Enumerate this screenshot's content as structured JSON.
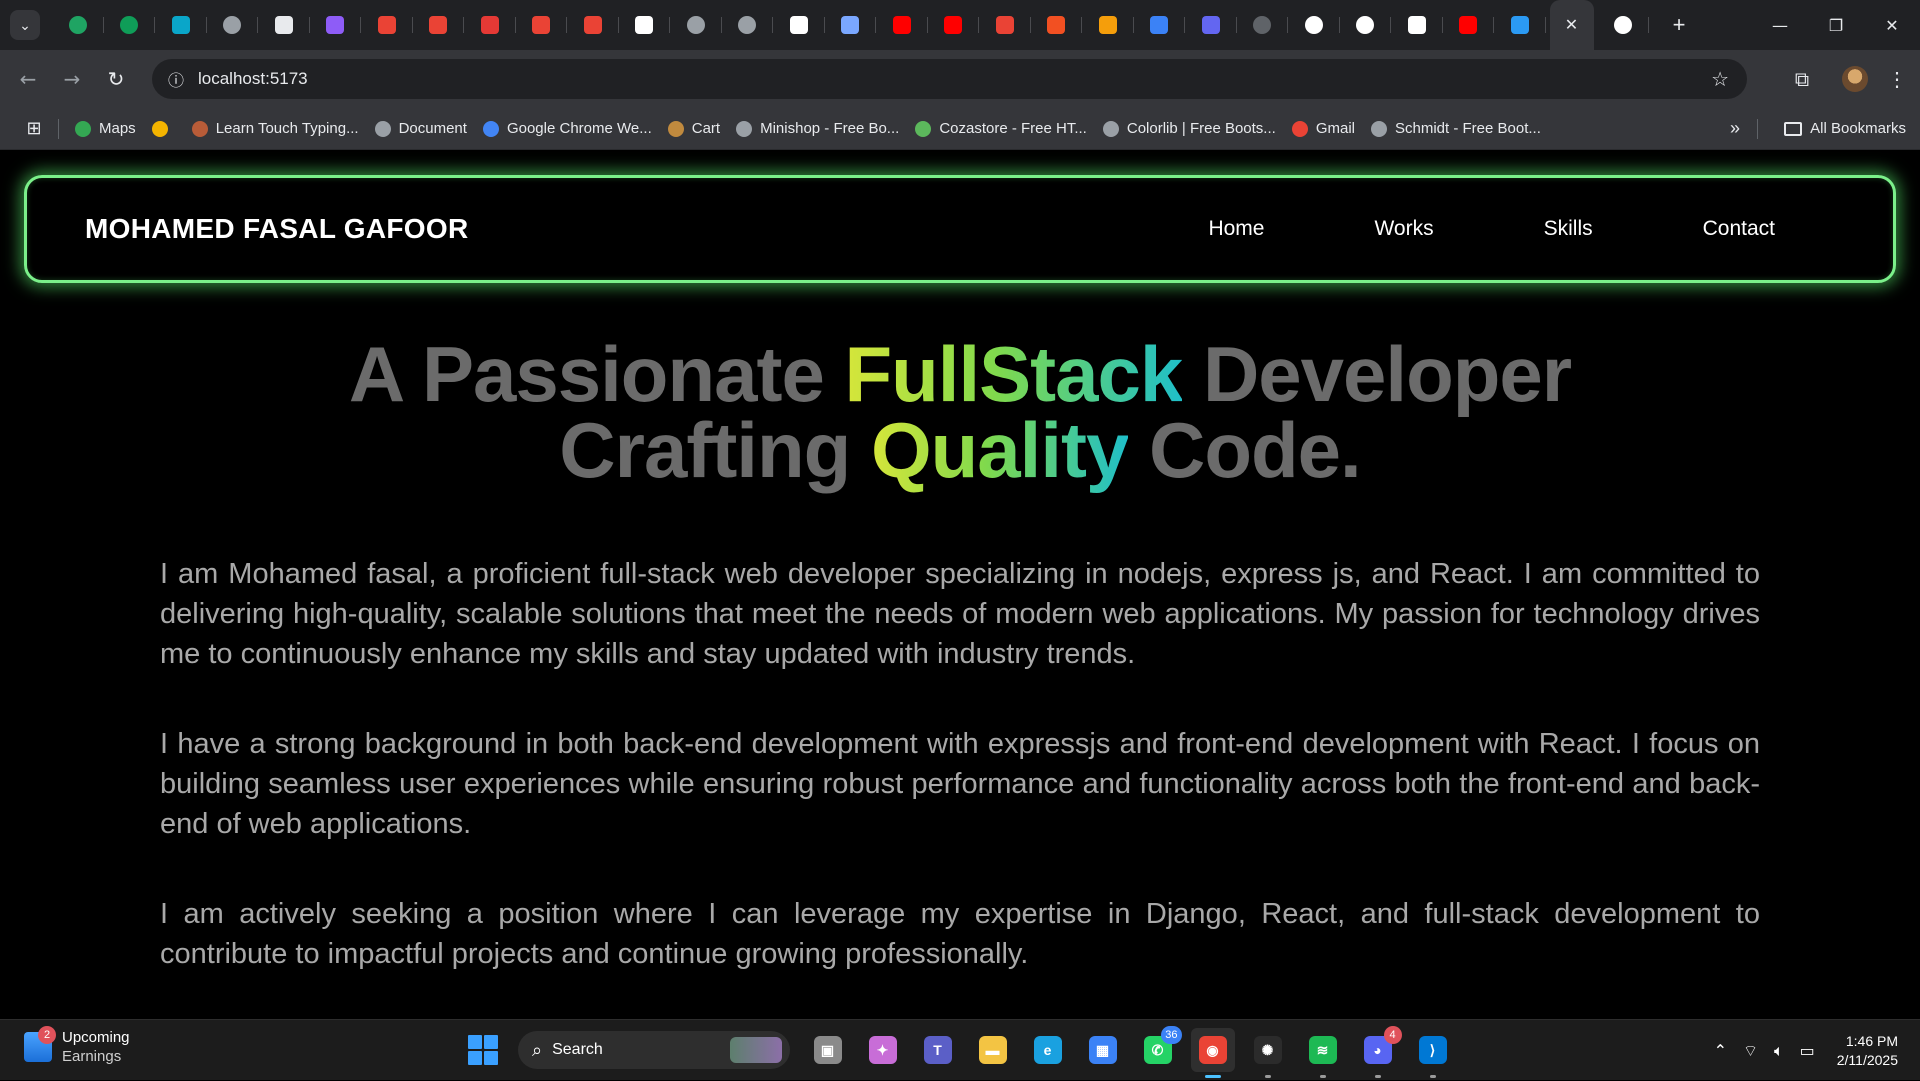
{
  "browser": {
    "tabs": [
      {
        "icon": "tab-list-icon"
      },
      {
        "icon": "google-drive-icon",
        "color": "#1fa463"
      },
      {
        "icon": "google-sheets-icon",
        "color": "#0f9d58"
      },
      {
        "icon": "app-icon",
        "color": "#0aa6c9"
      },
      {
        "icon": "globe-icon",
        "color": "#9aa0a6"
      },
      {
        "icon": "doc-icon",
        "color": "#e8eaed"
      },
      {
        "icon": "vuetify-icon",
        "color": "#8e5cf7"
      },
      {
        "icon": "gmail-icon",
        "color": "#ea4335"
      },
      {
        "icon": "gmail-icon",
        "color": "#ea4335"
      },
      {
        "icon": "n-icon",
        "color": "#e53935"
      },
      {
        "icon": "gmail-icon",
        "color": "#ea4335"
      },
      {
        "icon": "gmail-icon",
        "color": "#ea4335"
      },
      {
        "icon": "ve-icon",
        "color": "#ffffff"
      },
      {
        "icon": "globe-icon",
        "color": "#9aa0a6"
      },
      {
        "icon": "globe-icon",
        "color": "#9aa0a6"
      },
      {
        "icon": "github-icon",
        "color": "#ffffff"
      },
      {
        "icon": "cube-icon",
        "color": "#7aa7ff"
      },
      {
        "icon": "youtube-icon",
        "color": "#ff0000"
      },
      {
        "icon": "youtube-icon",
        "color": "#ff0000"
      },
      {
        "icon": "gmail-icon",
        "color": "#ea4335"
      },
      {
        "icon": "microsoft-icon",
        "color": "#f25022"
      },
      {
        "icon": "orange-app-icon",
        "color": "#f59e0b"
      },
      {
        "icon": "sync-icon",
        "color": "#3b82f6"
      },
      {
        "icon": "h-icon",
        "color": "#6366f1"
      },
      {
        "icon": "loading-icon",
        "color": "#5f6368"
      },
      {
        "icon": "google-icon",
        "color": "#ffffff"
      },
      {
        "icon": "google-icon",
        "color": "#ffffff"
      },
      {
        "icon": "ve-icon",
        "color": "#ffffff"
      },
      {
        "icon": "youtube-icon",
        "color": "#ff0000"
      },
      {
        "icon": "cloud-icon",
        "color": "#2b9af3"
      }
    ],
    "url": "localhost:5173",
    "bookmarks": [
      {
        "label": "Maps",
        "color": "#34a853"
      },
      {
        "label": "",
        "color": "#f4b400"
      },
      {
        "label": "Learn Touch Typing...",
        "color": "#b85c38"
      },
      {
        "label": "Document",
        "color": "#9aa0a6"
      },
      {
        "label": "Google Chrome We...",
        "color": "#4285f4"
      },
      {
        "label": "Cart",
        "color": "#c08a3e"
      },
      {
        "label": "Minishop - Free Bo...",
        "color": "#9aa0a6"
      },
      {
        "label": "Cozastore - Free HT...",
        "color": "#5cb85c"
      },
      {
        "label": "Colorlib | Free Boots...",
        "color": "#9aa0a6"
      },
      {
        "label": "Gmail",
        "color": "#ea4335"
      },
      {
        "label": "Schmidt - Free Boot...",
        "color": "#9aa0a6"
      }
    ],
    "all_bookmarks_label": "All Bookmarks"
  },
  "site": {
    "brand": "MOHAMED FASAL GAFOOR",
    "nav": [
      "Home",
      "Works",
      "Skills",
      "Contact"
    ],
    "accent": "#7bf08a",
    "hero": {
      "line1_pre": "A Passionate ",
      "line1_grad": "FullStack",
      "line1_post": " Developer",
      "line2_pre": "Crafting ",
      "line2_grad": "Quality",
      "line2_post": " Code."
    },
    "paragraphs": [
      "I am Mohamed fasal, a proficient full-stack web developer specializing in nodejs, express js, and React. I am committed to delivering high-quality, scalable solutions that meet the needs of modern web applications. My passion for technology drives me to continuously enhance my skills and stay updated with industry trends.",
      "I have a strong background in both back-end development with expressjs and front-end development with React. I focus on building seamless user experiences while ensuring robust performance and functionality across both the front-end and back-end of web applications.",
      "I am actively seeking a position where I can leverage my expertise in Django, React, and full-stack development to contribute to impactful projects and continue growing professionally."
    ]
  },
  "taskbar": {
    "widget_badge": "2",
    "widget_title": "Upcoming",
    "widget_sub": "Earnings",
    "search_label": "Search",
    "apps": [
      {
        "name": "task-view-icon",
        "color": "#8a8a8a",
        "glyph": "▣"
      },
      {
        "name": "copilot-icon",
        "color": "#c86dd7",
        "glyph": "✦"
      },
      {
        "name": "teams-icon",
        "color": "#5b5fc7",
        "glyph": "T"
      },
      {
        "name": "file-explorer-icon",
        "color": "#f3c443",
        "glyph": "▬"
      },
      {
        "name": "edge-icon",
        "color": "#1aa1e0",
        "glyph": "e"
      },
      {
        "name": "microsoft-store-icon",
        "color": "#3b82f6",
        "glyph": "▦"
      },
      {
        "name": "whatsapp-icon",
        "color": "#25d366",
        "glyph": "✆",
        "badge": "36",
        "badge_color": "#3b82f6"
      },
      {
        "name": "chrome-icon",
        "color": "#ea4335",
        "glyph": "◉",
        "state": "active"
      },
      {
        "name": "chatgpt-icon",
        "color": "#2b2b2b",
        "glyph": "✺",
        "state": "running"
      },
      {
        "name": "spotify-icon",
        "color": "#1db954",
        "glyph": "≋",
        "state": "running"
      },
      {
        "name": "discord-icon",
        "color": "#5865f2",
        "glyph": "◕",
        "badge": "4",
        "badge_color": "#e0525b",
        "state": "running"
      },
      {
        "name": "vscode-icon",
        "color": "#0078d4",
        "glyph": "⟩",
        "state": "running"
      }
    ],
    "time": "1:46 PM",
    "date": "2/11/2025"
  }
}
